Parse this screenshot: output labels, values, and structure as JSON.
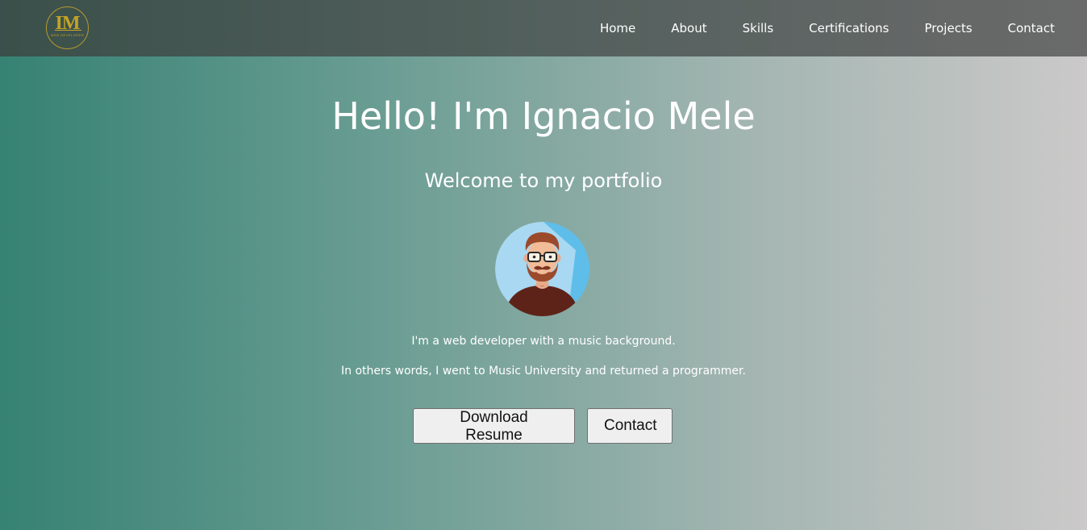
{
  "logo": {
    "monogram": "IM",
    "subtitle": "WEB DEVELOPER",
    "color": "#c3a325"
  },
  "nav": {
    "items": [
      {
        "label": "Home"
      },
      {
        "label": "About"
      },
      {
        "label": "Skills"
      },
      {
        "label": "Certifications"
      },
      {
        "label": "Projects"
      },
      {
        "label": "Contact"
      }
    ]
  },
  "hero": {
    "title": "Hello! I'm Ignacio Mele",
    "subtitle": "Welcome to my portfolio",
    "bio_line1": "I'm a web developer with a music background.",
    "bio_line2": "In others words, I went to Music University and returned a programmer.",
    "buttons": {
      "resume": "Download Resume",
      "contact": "Contact"
    }
  },
  "colors": {
    "gradient_start": "#368273",
    "gradient_end": "#cbc9c9",
    "nav_start": "#3b504a",
    "nav_end": "#6a6a6a",
    "avatar_bg": "#a8d8f2",
    "avatar_shirt": "#5e2318"
  }
}
